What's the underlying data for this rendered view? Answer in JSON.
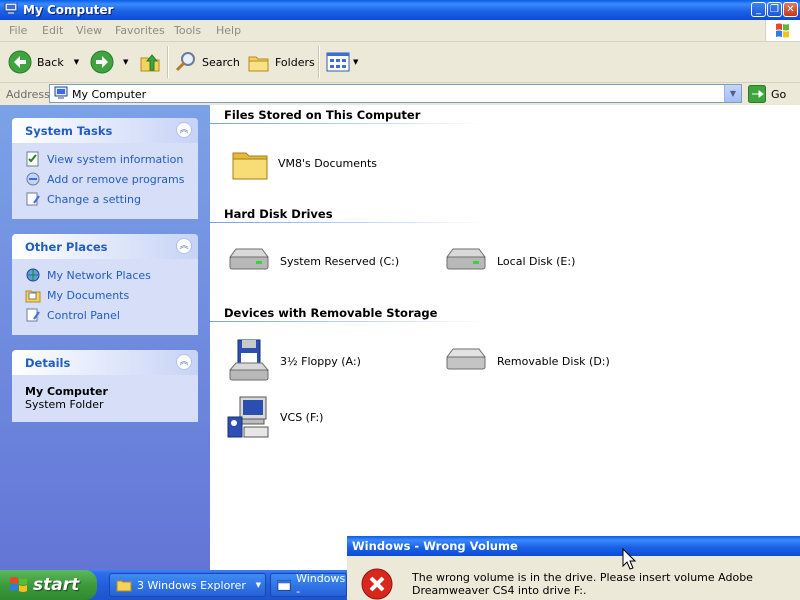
{
  "window": {
    "title": "My Computer",
    "controls": [
      "minimize",
      "restore",
      "close"
    ]
  },
  "menu": [
    "File",
    "Edit",
    "View",
    "Favorites",
    "Tools",
    "Help"
  ],
  "toolbar": {
    "back": "Back",
    "search": "Search",
    "folders": "Folders"
  },
  "address": {
    "label": "Address",
    "value": "My Computer",
    "go": "Go"
  },
  "tasks": {
    "system": {
      "title": "System Tasks",
      "links": [
        "View system information",
        "Add or remove programs",
        "Change a setting"
      ]
    },
    "other": {
      "title": "Other Places",
      "links": [
        "My Network Places",
        "My Documents",
        "Control Panel"
      ]
    },
    "details": {
      "title": "Details",
      "name": "My Computer",
      "type": "System Folder"
    }
  },
  "sections": {
    "stored": {
      "title": "Files Stored on This Computer",
      "items": [
        "VM8's Documents"
      ]
    },
    "hdd": {
      "title": "Hard Disk Drives",
      "items": [
        "System Reserved (C:)",
        "Local Disk (E:)"
      ]
    },
    "removable": {
      "title": "Devices with Removable Storage",
      "items": [
        "3½ Floppy (A:)",
        "Removable Disk (D:)",
        "VCS (F:)"
      ]
    }
  },
  "taskbar": {
    "start": "start",
    "tasks": [
      "3 Windows Explorer",
      "Windows -"
    ]
  },
  "dialog": {
    "title": "Windows - Wrong Volume",
    "message": "The wrong volume is in the drive. Please insert volume Adobe Dreamweaver CS4 into drive F:."
  },
  "colors": {
    "titlebar": "#0b4bd8",
    "taskpane": "#6f8fe0",
    "link": "#215dc6",
    "start": "#3d9a3d"
  }
}
